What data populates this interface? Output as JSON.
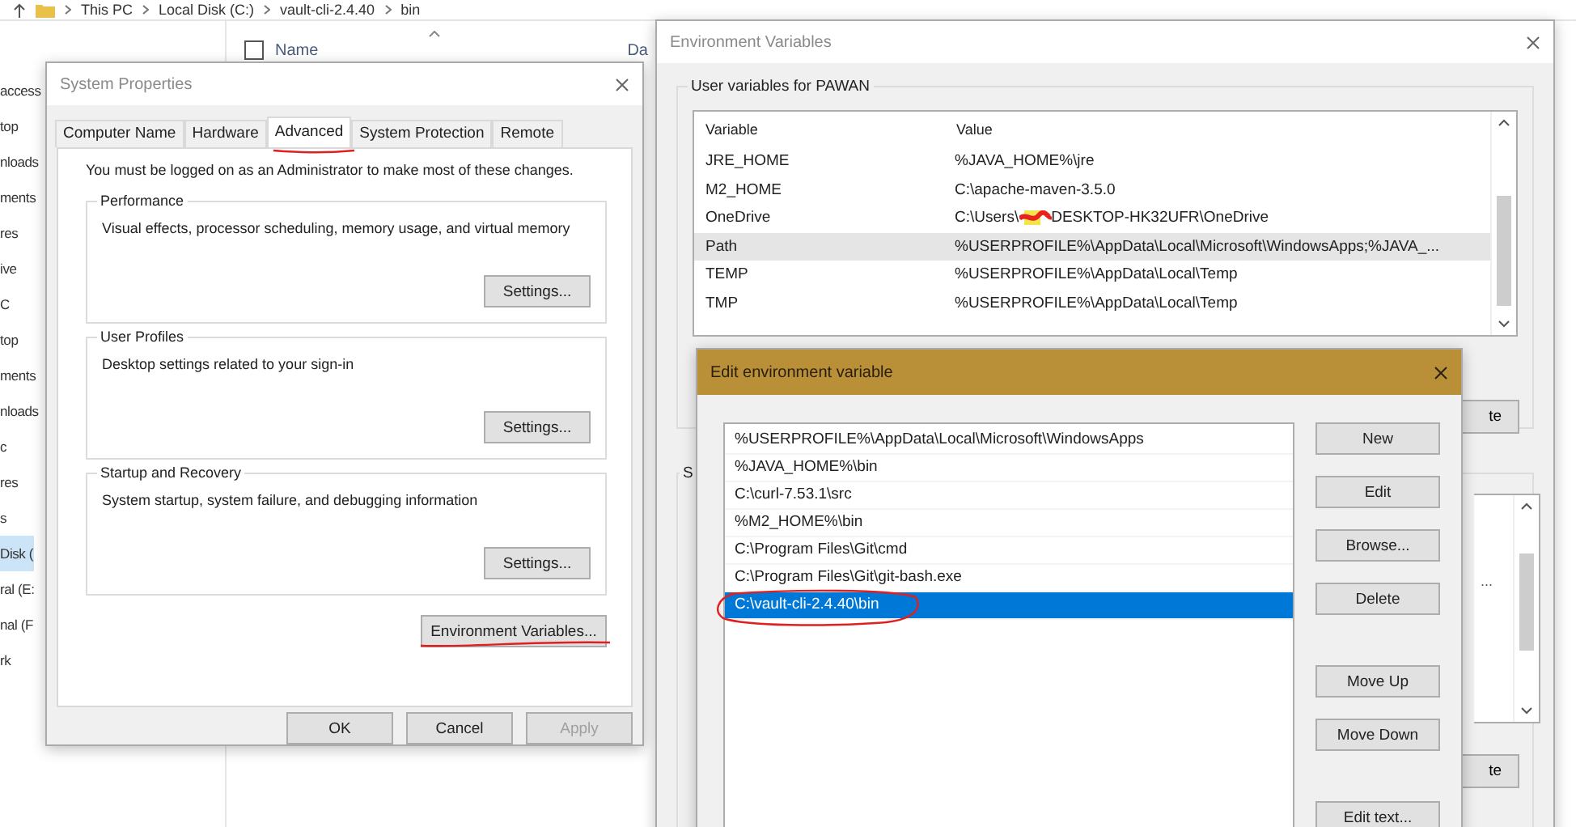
{
  "explorer": {
    "breadcrumb": [
      "This PC",
      "Local Disk (C:)",
      "vault-cli-2.4.40",
      "bin"
    ],
    "columns": [
      "Name",
      "Da"
    ],
    "select_all_checked": false,
    "nav_items": [
      {
        "label": "access",
        "selected": false
      },
      {
        "label": "top",
        "selected": false
      },
      {
        "label": "nloads",
        "selected": false
      },
      {
        "label": "ments",
        "selected": false
      },
      {
        "label": "res",
        "selected": false
      },
      {
        "label": "ive",
        "selected": false
      },
      {
        "label": "C",
        "selected": false
      },
      {
        "label": "top",
        "selected": false
      },
      {
        "label": "ments",
        "selected": false
      },
      {
        "label": "nloads",
        "selected": false
      },
      {
        "label": "c",
        "selected": false
      },
      {
        "label": "res",
        "selected": false
      },
      {
        "label": "s",
        "selected": false
      },
      {
        "label": "Disk (",
        "selected": true
      },
      {
        "label": "ral (E:",
        "selected": false
      },
      {
        "label": "nal (F",
        "selected": false
      },
      {
        "label": "rk",
        "selected": false
      }
    ]
  },
  "system_properties": {
    "title": "System Properties",
    "tabs": [
      {
        "label": "Computer Name",
        "selected": false
      },
      {
        "label": "Hardware",
        "selected": false
      },
      {
        "label": "Advanced",
        "selected": true
      },
      {
        "label": "System Protection",
        "selected": false
      },
      {
        "label": "Remote",
        "selected": false
      }
    ],
    "notice": "You must be logged on as an Administrator to make most of these changes.",
    "groups": [
      {
        "title": "Performance",
        "description": "Visual effects, processor scheduling, memory usage, and virtual memory",
        "button": "Settings..."
      },
      {
        "title": "User Profiles",
        "description": "Desktop settings related to your sign-in",
        "button": "Settings..."
      },
      {
        "title": "Startup and Recovery",
        "description": "System startup, system failure, and debugging information",
        "button": "Settings..."
      }
    ],
    "env_button": "Environment Variables...",
    "buttons": [
      {
        "label": "OK",
        "disabled": false
      },
      {
        "label": "Cancel",
        "disabled": false
      },
      {
        "label": "Apply",
        "disabled": true
      }
    ]
  },
  "environment_variables": {
    "title": "Environment Variables",
    "user_group": "User variables for PAWAN",
    "columns": [
      "Variable",
      "Value"
    ],
    "rows": [
      {
        "variable": "JRE_HOME",
        "value": [
          "%JAVA_HOME%\\jre"
        ],
        "selected": false
      },
      {
        "variable": "M2_HOME",
        "value": [
          "C:\\apache-maven-3.5.0"
        ],
        "selected": false
      },
      {
        "variable": "OneDrive",
        "value": [
          "C:\\Users\\",
          "DESKTOP-HK32UFR\\OneDrive"
        ],
        "selected": false
      },
      {
        "variable": "Path",
        "value": [
          "%USERPROFILE%\\AppData\\Local\\Microsoft\\WindowsApps;%JAVA_..."
        ],
        "selected": true
      },
      {
        "variable": "TEMP",
        "value": [
          "%USERPROFILE%\\AppData\\Local\\Temp"
        ],
        "selected": false
      },
      {
        "variable": "TMP",
        "value": [
          "%USERPROFILE%\\AppData\\Local\\Temp"
        ],
        "selected": false
      }
    ],
    "hidden_buttons": [
      "te",
      "te"
    ],
    "system_group": "S",
    "hidden_cell": "..."
  },
  "edit_dialog": {
    "title": "Edit environment variable",
    "items": [
      {
        "text": "%USERPROFILE%\\AppData\\Local\\Microsoft\\WindowsApps",
        "selected": false
      },
      {
        "text": "%JAVA_HOME%\\bin",
        "selected": false
      },
      {
        "text": "C:\\curl-7.53.1\\src",
        "selected": false
      },
      {
        "text": "%M2_HOME%\\bin",
        "selected": false
      },
      {
        "text": "C:\\Program Files\\Git\\cmd",
        "selected": false
      },
      {
        "text": "C:\\Program Files\\Git\\git-bash.exe",
        "selected": false
      },
      {
        "text": "C:\\vault-cli-2.4.40\\bin",
        "selected": true
      }
    ],
    "button_groups": [
      [
        "New",
        "Edit",
        "Browse...",
        "Delete"
      ],
      [
        "Move Up",
        "Move Down"
      ],
      [
        "Edit text..."
      ]
    ]
  }
}
